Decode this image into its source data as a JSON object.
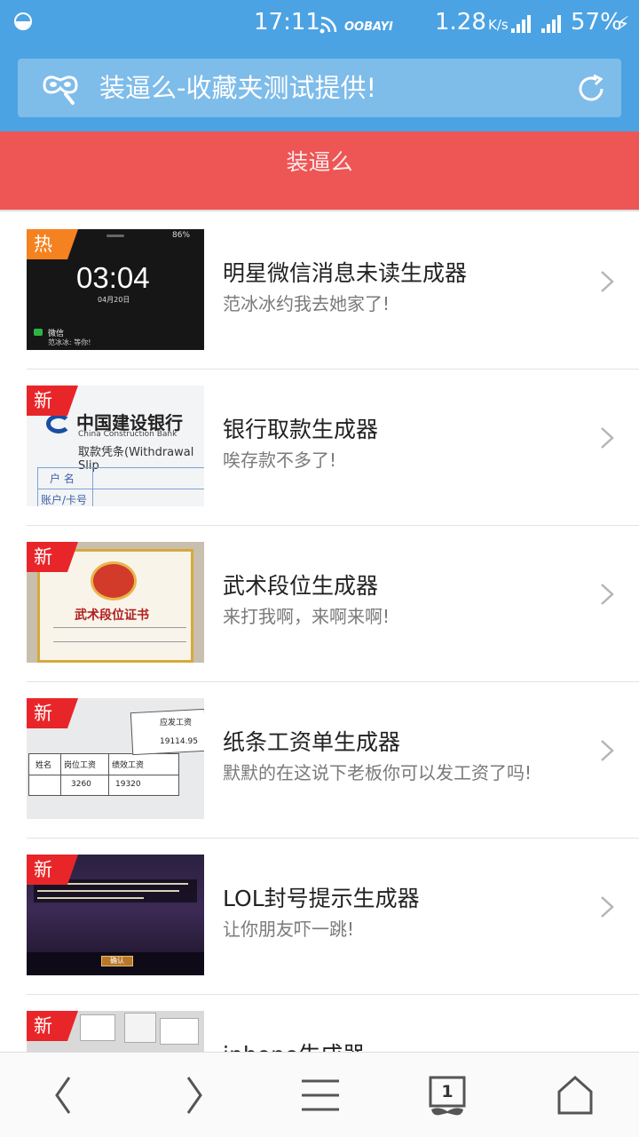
{
  "status_bar": {
    "time": "17:11",
    "carrier": "OOBAYI",
    "speed": "1.28",
    "speed_unit": "K/s",
    "battery": "57%"
  },
  "address_bar": {
    "url_text": "装逼么-收藏夹测试提供!",
    "left_icon": "mask-search-icon",
    "right_icon": "refresh-icon"
  },
  "header": {
    "title": "装逼么",
    "color": "#ee5555"
  },
  "colors": {
    "top_blue": "#4ca3e3",
    "hot_badge": "#f58220",
    "new_badge": "#e8262a"
  },
  "items": [
    {
      "badge": "热",
      "badge_type": "hot",
      "title": "明星微信消息未读生成器",
      "subtitle": "范冰冰约我去她家了!",
      "thumb": {
        "time": "03:04",
        "date": "04月20日",
        "app": "微信",
        "msg": "范冰冰: 等你!",
        "battery": "86%"
      }
    },
    {
      "badge": "新",
      "badge_type": "new",
      "title": "银行取款生成器",
      "subtitle": "唉存款不多了!",
      "thumb": {
        "bank": "中国建设银行",
        "bank_en": "China Construction Bank",
        "line": "取款凭条(Withdrawal Slip",
        "field1": "户 名",
        "field2": "账户/卡号"
      }
    },
    {
      "badge": "新",
      "badge_type": "new",
      "title": "武术段位生成器",
      "subtitle": "来打我啊，来啊来啊!",
      "thumb": {
        "cert": "武术段位证书"
      }
    },
    {
      "badge": "新",
      "badge_type": "new",
      "title": "纸条工资单生成器",
      "subtitle": "默默的在这说下老板你可以发工资了吗!",
      "thumb": {
        "col1": "姓名",
        "col2": "岗位工资",
        "col3": "绩效工资",
        "label": "应发工资",
        "v1": "3260",
        "v2": "19320",
        "v3": "19114.95"
      }
    },
    {
      "badge": "新",
      "badge_type": "new",
      "title": "LOL封号提示生成器",
      "subtitle": "让你朋友吓一跳!",
      "thumb": {
        "button": "确认"
      }
    },
    {
      "badge": "新",
      "badge_type": "new",
      "title": "iphone生成器",
      "subtitle": "",
      "thumb": {}
    }
  ],
  "bottom_nav": {
    "tab_count": "1",
    "icons": [
      "back-icon",
      "forward-icon",
      "menu-icon",
      "tabs-icon",
      "home-icon"
    ]
  }
}
